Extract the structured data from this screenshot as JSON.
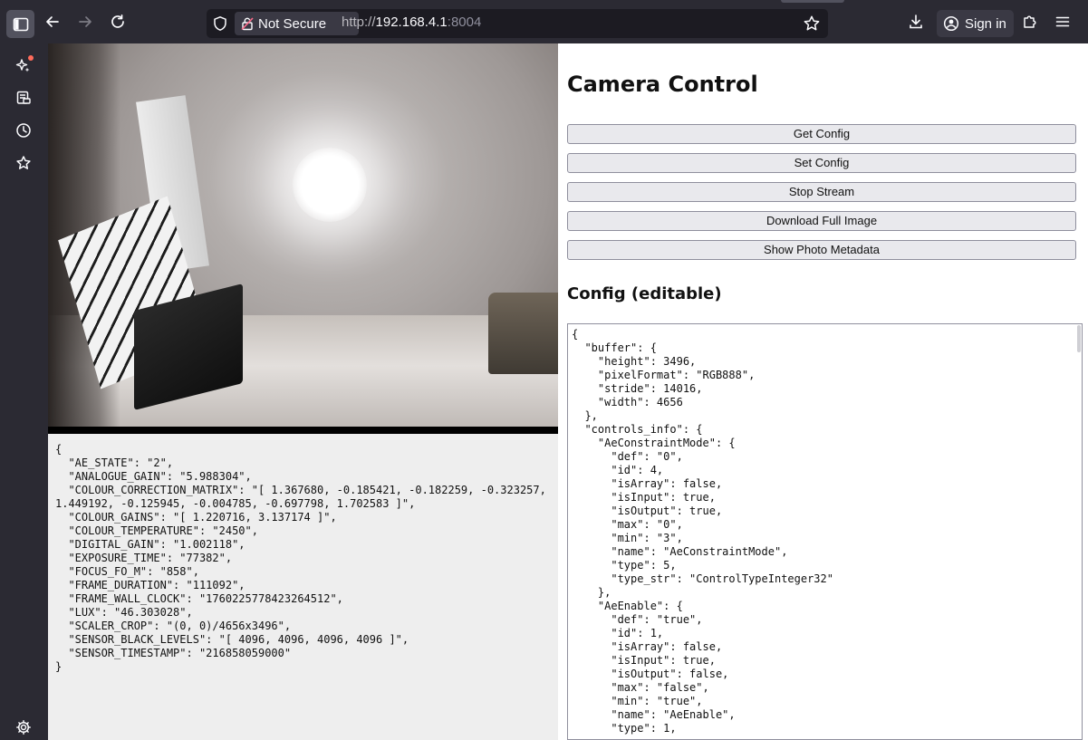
{
  "browser": {
    "security_label": "Not Secure",
    "url_scheme": "http://",
    "url_host": "192.168.4.1",
    "url_port": ":8004",
    "sign_in_label": "Sign in"
  },
  "icons": {
    "sidebar_toggle": "sidebar-toggle-icon",
    "back": "back-arrow-icon",
    "forward": "forward-arrow-icon",
    "reload": "reload-icon",
    "shield": "shield-icon",
    "lock": "broken-lock-icon",
    "bookmark": "star-icon",
    "downloads": "download-icon",
    "account": "account-icon",
    "extensions": "puzzle-icon",
    "menu": "hamburger-menu-icon",
    "ai": "sparkle-icon",
    "synced_tabs": "tabs-icon",
    "history": "clock-icon",
    "bookmarks": "star-icon",
    "settings": "gear-icon"
  },
  "page": {
    "title": "Camera Control",
    "buttons": {
      "get_config": "Get Config",
      "set_config": "Set Config",
      "stop_stream": "Stop Stream",
      "download_full": "Download Full Image",
      "show_metadata": "Show Photo Metadata"
    },
    "config_heading": "Config (editable)",
    "metadata_text": "{\n  \"AE_STATE\": \"2\",\n  \"ANALOGUE_GAIN\": \"5.988304\",\n  \"COLOUR_CORRECTION_MATRIX\": \"[ 1.367680, -0.185421, -0.182259, -0.323257, 1.449192, -0.125945, -0.004785, -0.697798, 1.702583 ]\",\n  \"COLOUR_GAINS\": \"[ 1.220716, 3.137174 ]\",\n  \"COLOUR_TEMPERATURE\": \"2450\",\n  \"DIGITAL_GAIN\": \"1.002118\",\n  \"EXPOSURE_TIME\": \"77382\",\n  \"FOCUS_FO_M\": \"858\",\n  \"FRAME_DURATION\": \"111092\",\n  \"FRAME_WALL_CLOCK\": \"1760225778423264512\",\n  \"LUX\": \"46.303028\",\n  \"SCALER_CROP\": \"(0, 0)/4656x3496\",\n  \"SENSOR_BLACK_LEVELS\": \"[ 4096, 4096, 4096, 4096 ]\",\n  \"SENSOR_TIMESTAMP\": \"216858059000\"\n}",
    "config_text": "{\n  \"buffer\": {\n    \"height\": 3496,\n    \"pixelFormat\": \"RGB888\",\n    \"stride\": 14016,\n    \"width\": 4656\n  },\n  \"controls_info\": {\n    \"AeConstraintMode\": {\n      \"def\": \"0\",\n      \"id\": 4,\n      \"isArray\": false,\n      \"isInput\": true,\n      \"isOutput\": true,\n      \"max\": \"0\",\n      \"min\": \"3\",\n      \"name\": \"AeConstraintMode\",\n      \"type\": 5,\n      \"type_str\": \"ControlTypeInteger32\"\n    },\n    \"AeEnable\": {\n      \"def\": \"true\",\n      \"id\": 1,\n      \"isArray\": false,\n      \"isInput\": true,\n      \"isOutput\": false,\n      \"max\": \"false\",\n      \"min\": \"true\",\n      \"name\": \"AeEnable\",\n      \"type\": 1,"
  }
}
